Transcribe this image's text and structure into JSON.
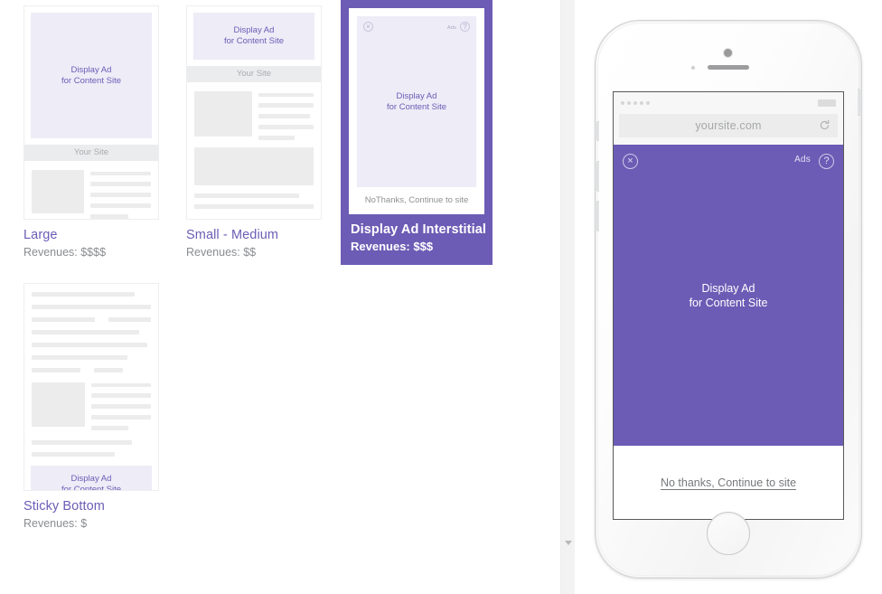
{
  "ad_text": {
    "line1": "Display Ad",
    "line2": "for Content Site"
  },
  "site_label": "Your Site",
  "cards": [
    {
      "id": "large",
      "title": "Large",
      "revenues": "Revenues: $$$$",
      "ad_line1": "Display Ad",
      "ad_line2": "for Content Site",
      "site_label": "Your Site",
      "selected": "false"
    },
    {
      "id": "small-medium",
      "title": "Small - Medium",
      "revenues": "Revenues: $$",
      "ad_line1": "Display Ad",
      "ad_line2": "for Content Site",
      "site_label": "Your Site",
      "selected": "false"
    },
    {
      "id": "display-ad-interstitial",
      "title": "Display Ad Interstitial",
      "revenues": "Revenues: $$$",
      "ad_line1": "Display Ad",
      "ad_line2": "for Content Site",
      "ads_label": "Ads",
      "close_glyph": "×",
      "help_glyph": "?",
      "footer": "NoThanks, Continue to site",
      "selected": "true"
    },
    {
      "id": "sticky-bottom",
      "title": "Sticky Bottom",
      "revenues": "Revenues: $",
      "ad_line1": "Display Ad",
      "ad_line2": "for Content Site",
      "selected": "false"
    }
  ],
  "phone": {
    "url": "yoursite.com",
    "ad_line1": "Display Ad",
    "ad_line2": "for Content Site",
    "ads_label": "Ads",
    "close_glyph": "×",
    "help_glyph": "?",
    "continue_link": "No thanks, Continue to site"
  },
  "colors": {
    "accent_purple": "#6c5cb5",
    "ad_lavender": "#edecf7",
    "skeleton_gray": "#ececec",
    "muted_text": "#8a8d90"
  }
}
